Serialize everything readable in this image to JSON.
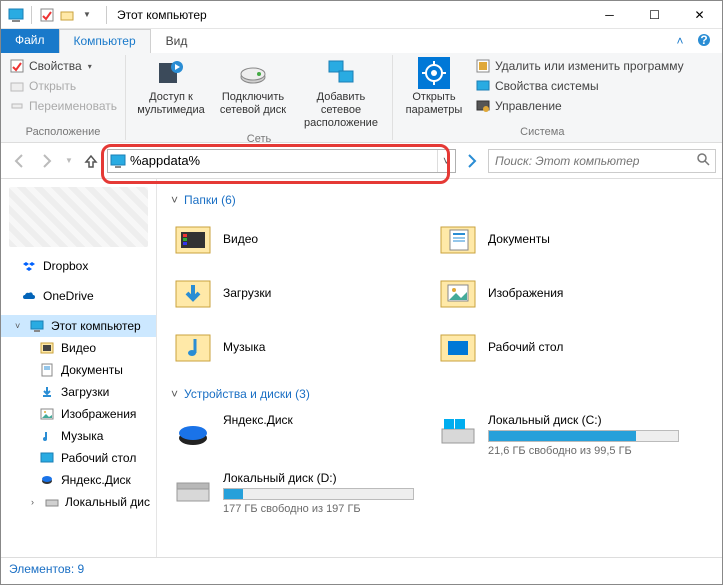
{
  "title": "Этот компьютер",
  "tabs": {
    "file": "Файл",
    "computer": "Компьютер",
    "view": "Вид"
  },
  "ribbon": {
    "location": {
      "properties": "Свойства",
      "open": "Открыть",
      "rename": "Переименовать",
      "groupLabel": "Расположение"
    },
    "network": {
      "media": "Доступ к мультимедиа",
      "mapDrive": "Подключить сетевой диск",
      "addLocation": "Добавить сетевое расположение",
      "groupLabel": "Сеть"
    },
    "system": {
      "openSettings": "Открыть параметры",
      "uninstall": "Удалить или изменить программу",
      "sysProps": "Свойства системы",
      "manage": "Управление",
      "groupLabel": "Система"
    }
  },
  "address": {
    "value": "%appdata%"
  },
  "search": {
    "placeholder": "Поиск: Этот компьютер"
  },
  "sidebar": {
    "dropbox": "Dropbox",
    "onedrive": "OneDrive",
    "thispc": "Этот компьютер",
    "video": "Видео",
    "documents": "Документы",
    "downloads": "Загрузки",
    "pictures": "Изображения",
    "music": "Музыка",
    "desktop": "Рабочий стол",
    "yadisk": "Яндекс.Диск",
    "localdisk": "Локальный дис"
  },
  "sections": {
    "folders": "Папки (6)",
    "drives": "Устройства и диски (3)"
  },
  "folders": {
    "video": "Видео",
    "documents": "Документы",
    "downloads": "Загрузки",
    "pictures": "Изображения",
    "music": "Музыка",
    "desktop": "Рабочий стол"
  },
  "drives": {
    "yadisk": {
      "name": "Яндекс.Диск"
    },
    "c": {
      "name": "Локальный диск (C:)",
      "free": "21,6 ГБ свободно из 99,5 ГБ",
      "fill": 78
    },
    "d": {
      "name": "Локальный диск (D:)",
      "free": "177 ГБ свободно из 197 ГБ",
      "fill": 10
    }
  },
  "status": "Элементов: 9"
}
